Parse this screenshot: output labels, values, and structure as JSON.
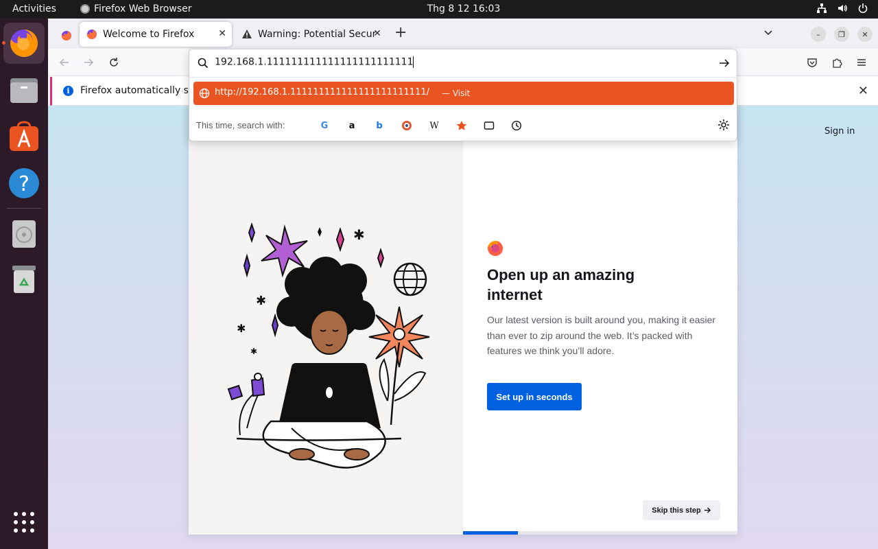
{
  "topbar": {
    "activities": "Activities",
    "app_name": "Firefox Web Browser",
    "clock": "Thg 8 12  16:03"
  },
  "dock": {
    "items": [
      "firefox-icon",
      "files-icon",
      "app-center-icon",
      "help-icon",
      "disc-icon",
      "trash-icon",
      "show-apps-icon"
    ]
  },
  "tabs": [
    {
      "title": "Welcome to Firefox",
      "selected": true
    },
    {
      "title": "Warning: Potential Security Risk Ahead",
      "selected": false
    }
  ],
  "urlbar": {
    "value": "192.168.1.111111111111111111111111",
    "result_url": "http://192.168.1.111111111111111111111111/",
    "result_action": "— Visit",
    "oneoff_label": "This time, search with:",
    "engines": [
      "Google",
      "Amazon",
      "Bing",
      "DuckDuckGo",
      "Wikipedia",
      "Bookmarks",
      "Tabs",
      "History"
    ]
  },
  "notification": {
    "message": "Firefox automatically sent a crash report to Mozilla to help improve Firefox."
  },
  "page": {
    "signin": "Sign in",
    "headline": "Open up an amazing internet",
    "body": "Our latest version is built around you, making it easier than ever to zip around the web. It’s packed with features we think you’ll adore.",
    "cta": "Set up in seconds",
    "skip": "Skip this step",
    "progress": 0.2
  },
  "colors": {
    "accent_orange": "#e95420",
    "primary_blue": "#0061e0",
    "dock_bg": "#2c1a28"
  }
}
